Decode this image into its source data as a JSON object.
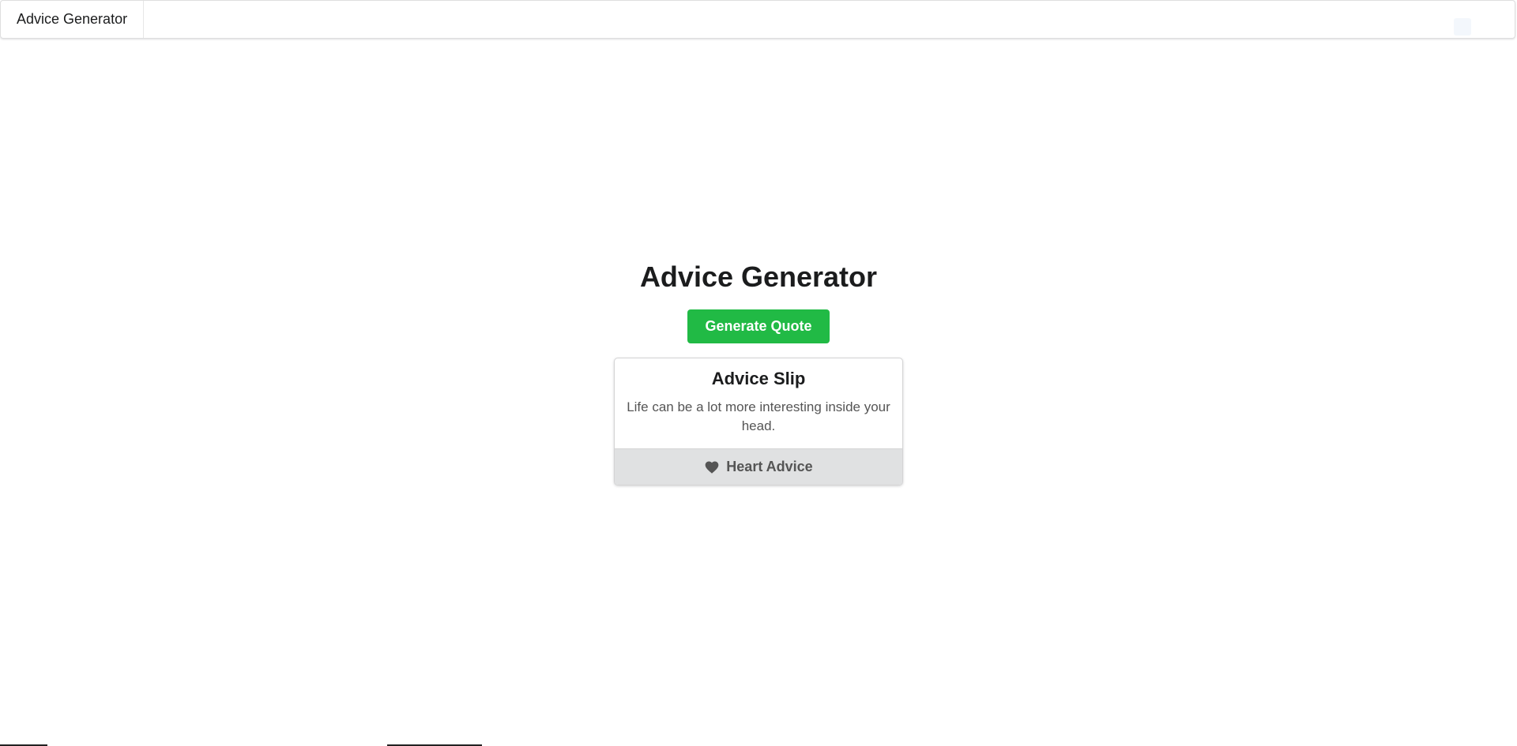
{
  "nav": {
    "brand": "Advice Generator"
  },
  "page": {
    "title": "Advice Generator",
    "generate_button": "Generate Quote"
  },
  "advice_card": {
    "header": "Advice Slip",
    "text": "Life can be a lot more interesting inside your head.",
    "footer_label": "Heart Advice",
    "footer_icon": "heart-icon"
  },
  "colors": {
    "primary_green": "#21ba45",
    "footer_gray": "#e0e1e2"
  }
}
